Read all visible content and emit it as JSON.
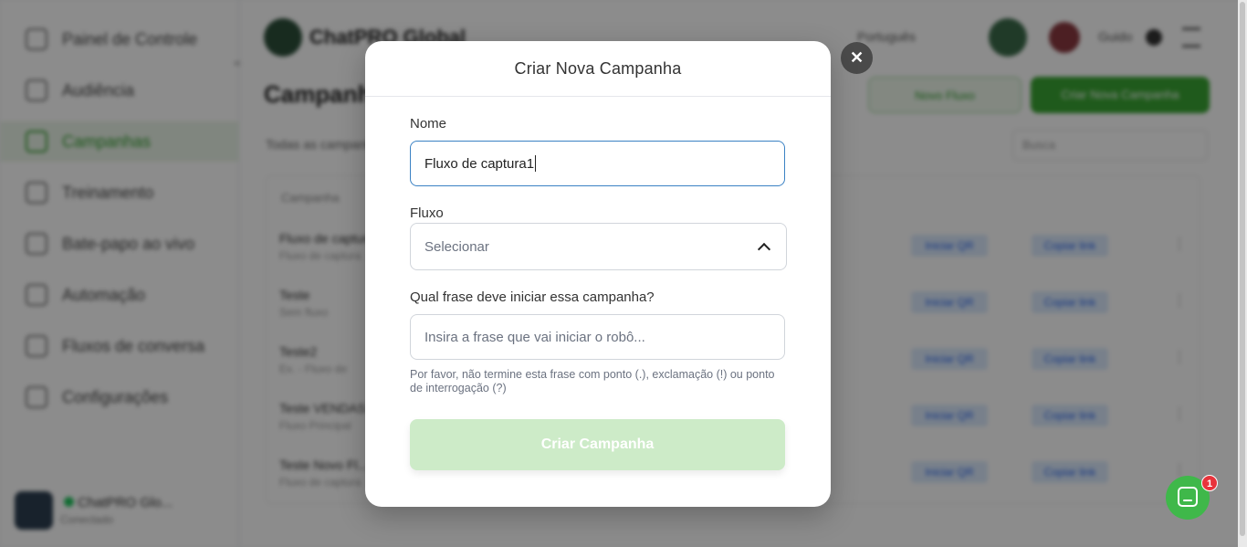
{
  "sidebar": {
    "items": [
      {
        "label": "Painel de Controle",
        "icon": "dashboard-icon"
      },
      {
        "label": "Audiência",
        "icon": "audience-icon"
      },
      {
        "label": "Campanhas",
        "icon": "campaign-icon",
        "active": true
      },
      {
        "label": "Treinamento",
        "icon": "training-icon"
      },
      {
        "label": "Bate-papo ao vivo",
        "icon": "chat-icon"
      },
      {
        "label": "Automação",
        "icon": "automation-icon"
      },
      {
        "label": "Fluxos de conversa",
        "icon": "flow-icon"
      },
      {
        "label": "Configurações",
        "icon": "settings-icon"
      }
    ],
    "workspace": {
      "name": "ChatPRO Glo...",
      "status": "Conectado"
    }
  },
  "topbar": {
    "brand": "ChatPRO Global",
    "language": "Português",
    "user": "Guido"
  },
  "page": {
    "title": "Campanhas",
    "subtitle": "Todas as campanhas",
    "secondary_button": "Novo Fluxo",
    "primary_button": "Criar Nova Campanha",
    "search_placeholder": "Busca"
  },
  "table": {
    "header": "Campanha",
    "rows": [
      {
        "name": "Fluxo de captura",
        "sub": "Fluxo de captura"
      },
      {
        "name": "Teste",
        "sub": "Sem fluxo"
      },
      {
        "name": "Teste2",
        "sub": "Ex. - Fluxo de"
      },
      {
        "name": "Teste VENDAS",
        "sub": "Fluxo Principal"
      },
      {
        "name": "Teste Novo Fl...",
        "sub": "Fluxo de captura"
      }
    ],
    "tag1": "Iniciar QR",
    "tag2": "Copiar link"
  },
  "modal": {
    "title": "Criar Nova Campanha",
    "name_label": "Nome",
    "name_value": "Fluxo de captura1",
    "flow_label": "Fluxo",
    "flow_placeholder": "Selecionar",
    "phrase_label": "Qual frase deve iniciar essa campanha?",
    "phrase_placeholder": "Insira a frase que vai iniciar o robô...",
    "helper": "Por favor, não termine esta frase com ponto (.), exclamação (!) ou ponto de interrogação (?)",
    "submit_label": "Criar Campanha",
    "close_glyph": "✕"
  },
  "chat_widget": {
    "badge": "1"
  },
  "colors": {
    "accent_green": "#3aa533",
    "submit_disabled": "#cdebc8",
    "focus_border": "#3b82c4",
    "badge_red": "#e8333b"
  }
}
